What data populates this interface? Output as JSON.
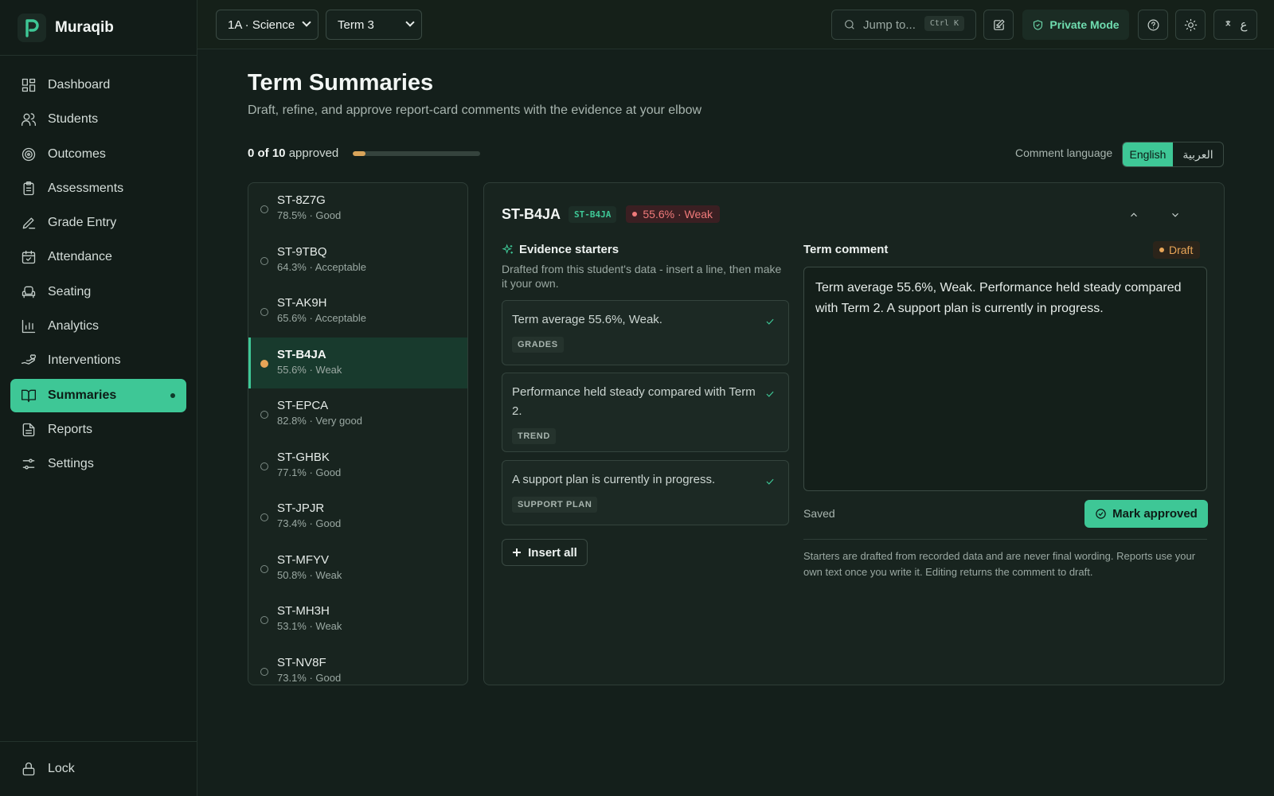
{
  "app": {
    "name": "Muraqib"
  },
  "nav": {
    "items": [
      {
        "label": "Dashboard",
        "icon": "dashboard-icon"
      },
      {
        "label": "Students",
        "icon": "users-icon"
      },
      {
        "label": "Outcomes",
        "icon": "target-icon"
      },
      {
        "label": "Assessments",
        "icon": "clipboard-icon"
      },
      {
        "label": "Grade Entry",
        "icon": "pen-icon"
      },
      {
        "label": "Attendance",
        "icon": "calendar-check-icon"
      },
      {
        "label": "Seating",
        "icon": "chair-icon"
      },
      {
        "label": "Analytics",
        "icon": "bar-chart-icon"
      },
      {
        "label": "Interventions",
        "icon": "hand-heart-icon"
      },
      {
        "label": "Summaries",
        "icon": "book-open-icon",
        "active": true
      },
      {
        "label": "Reports",
        "icon": "file-text-icon"
      },
      {
        "label": "Settings",
        "icon": "sliders-icon"
      }
    ],
    "lock_label": "Lock"
  },
  "topbar": {
    "class_select": "1A · Science",
    "term_select": "Term 3",
    "jump_placeholder": "Jump to...",
    "jump_shortcut": "Ctrl K",
    "private_mode": "Private Mode",
    "language_toggle": "ع"
  },
  "page": {
    "title": "Term Summaries",
    "subtitle": "Draft, refine, and approve report-card comments with the evidence at your elbow",
    "approved_count": "0 of 10",
    "approved_suffix": "approved",
    "approved_progress": 0.1,
    "comment_language_label": "Comment language",
    "languages": [
      "English",
      "العربية"
    ],
    "active_language": "English"
  },
  "students": [
    {
      "id": "ST-8Z7G",
      "meta": "78.5% · Good"
    },
    {
      "id": "ST-9TBQ",
      "meta": "64.3% · Acceptable"
    },
    {
      "id": "ST-AK9H",
      "meta": "65.6% · Acceptable"
    },
    {
      "id": "ST-B4JA",
      "meta": "55.6% · Weak",
      "active": true
    },
    {
      "id": "ST-EPCA",
      "meta": "82.8% · Very good"
    },
    {
      "id": "ST-GHBK",
      "meta": "77.1% · Good"
    },
    {
      "id": "ST-JPJR",
      "meta": "73.4% · Good"
    },
    {
      "id": "ST-MFYV",
      "meta": "50.8% · Weak"
    },
    {
      "id": "ST-MH3H",
      "meta": "53.1% · Weak"
    },
    {
      "id": "ST-NV8F",
      "meta": "73.1% · Good"
    }
  ],
  "detail": {
    "student_id": "ST-B4JA",
    "code": "ST-B4JA",
    "badge": "55.6% · Weak",
    "badge_color": "#f07a7a",
    "evidence_title": "Evidence starters",
    "evidence_subtitle": "Drafted from this student's data - insert a line, then make it your own.",
    "starters": [
      {
        "text": "Term average 55.6%, Weak.",
        "tag": "GRADES"
      },
      {
        "text": "Performance held steady compared with Term 2.",
        "tag": "TREND"
      },
      {
        "text": "A support plan is currently in progress.",
        "tag": "SUPPORT PLAN"
      }
    ],
    "insert_all": "Insert all",
    "comment_title": "Term comment",
    "status": "Draft",
    "comment_text": "Term average 55.6%, Weak. Performance held steady compared with Term 2. A support plan is currently in progress.",
    "saved_label": "Saved",
    "approve_label": "Mark approved",
    "note": "Starters are drafted from recorded data and are never final wording. Reports use your own text once you write it. Editing returns the comment to draft."
  },
  "colors": {
    "accent": "#3ec796",
    "warning": "#e7a557",
    "danger": "#f07a7a",
    "background": "#141f1b"
  }
}
